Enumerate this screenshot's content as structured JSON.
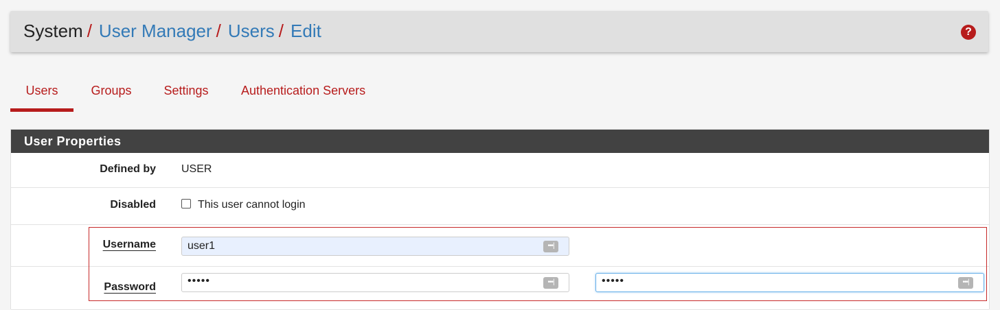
{
  "breadcrumb": {
    "root": "System",
    "separator": "/",
    "items": [
      "User Manager",
      "Users",
      "Edit"
    ]
  },
  "help_icon": "question-circle-icon",
  "tabs": [
    {
      "label": "Users",
      "active": true
    },
    {
      "label": "Groups",
      "active": false
    },
    {
      "label": "Settings",
      "active": false
    },
    {
      "label": "Authentication Servers",
      "active": false
    }
  ],
  "panel": {
    "title": "User Properties",
    "defined_by": {
      "label": "Defined by",
      "value": "USER"
    },
    "disabled": {
      "label": "Disabled",
      "checkbox_label": "This user cannot login",
      "checked": false
    },
    "username": {
      "label": "Username",
      "value": "user1"
    },
    "password": {
      "label": "Password",
      "value": "•••••",
      "confirm_value": "•••••"
    }
  },
  "colors": {
    "accent": "#b71c1c",
    "link": "#337ab7",
    "panel_header": "#424242",
    "highlight": "#c62828"
  }
}
